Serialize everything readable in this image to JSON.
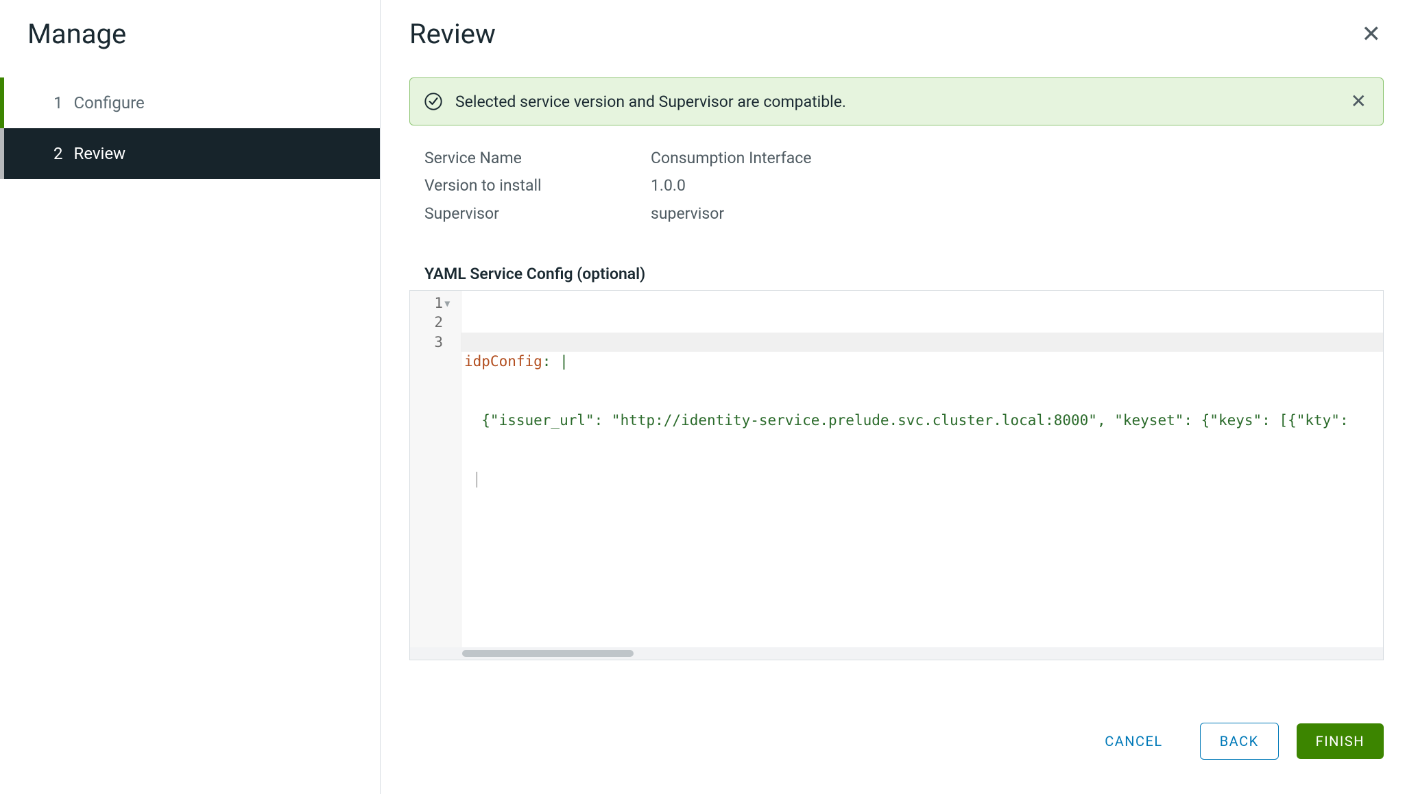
{
  "sidebar": {
    "title": "Manage",
    "steps": [
      {
        "num": "1",
        "label": "Configure"
      },
      {
        "num": "2",
        "label": "Review"
      }
    ]
  },
  "main": {
    "title": "Review",
    "alert": {
      "text": "Selected service version and Supervisor are compatible."
    },
    "fields": {
      "service_name_label": "Service Name",
      "service_name_value": "Consumption Interface",
      "version_label": "Version to install",
      "version_value": "1.0.0",
      "supervisor_label": "Supervisor",
      "supervisor_value": "supervisor"
    },
    "yaml": {
      "label": "YAML Service Config (optional)",
      "lines": {
        "l1_key": "idpConfig",
        "l1_sep": ": ",
        "l1_pipe": "|",
        "l2": "  {\"issuer_url\": \"http://identity-service.prelude.svc.cluster.local:8000\", \"keyset\": {\"keys\": [{\"kty\":"
      },
      "line_numbers": [
        "1",
        "2",
        "3"
      ]
    },
    "footer": {
      "cancel": "CANCEL",
      "back": "BACK",
      "finish": "FINISH"
    }
  }
}
